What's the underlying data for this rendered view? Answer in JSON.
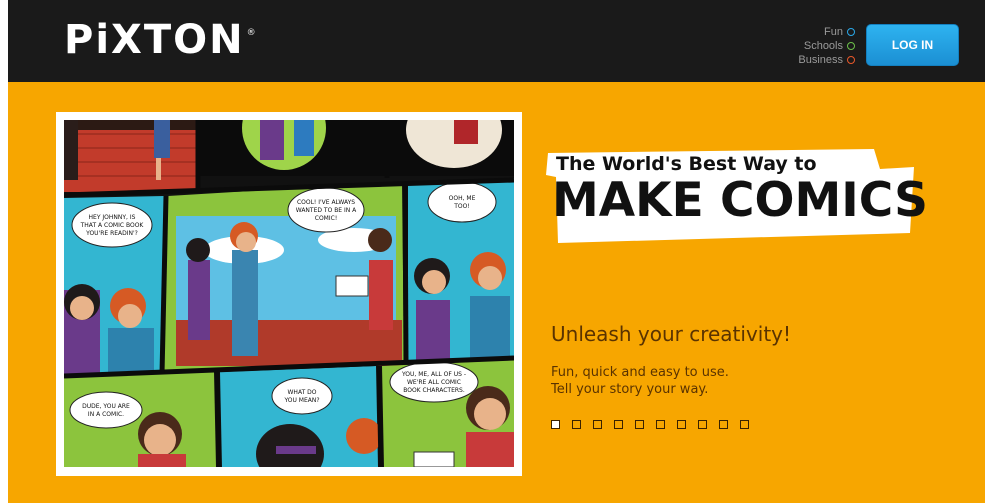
{
  "header": {
    "logo_text": "PiXTON",
    "logo_mark": "®",
    "nav": [
      {
        "label": "Fun",
        "color": "#2aa8e8"
      },
      {
        "label": "Schools",
        "color": "#6cc04a"
      },
      {
        "label": "Business",
        "color": "#e8582a"
      }
    ],
    "login_label": "LOG IN"
  },
  "hero": {
    "headline_small": "The World's Best Way to",
    "headline_big": "MAKE COMICS",
    "tagline": "Unleash your creativity!",
    "description_line1": "Fun, quick and easy to use.",
    "description_line2": "Tell your story your way.",
    "slide_count": 10,
    "active_slide": 1
  },
  "comic": {
    "bubbles": [
      "HEY JOHNNY, IS THAT A COMIC BOOK YOU'RE READIN'?",
      "COOL! I'VE ALWAYS WANTED TO BE IN A COMIC!",
      "OOH, ME TOO!",
      "DUDE, YOU ARE IN A COMIC.",
      "WHAT DO YOU MEAN?",
      "YOU, ME, ALL OF US - WE'RE ALL COMIC BOOK CHARACTERS."
    ]
  },
  "colors": {
    "background": "#f7a600",
    "header": "#1a1a1a",
    "login_button": "#1b8fd3",
    "text_brown": "#5a3300"
  }
}
